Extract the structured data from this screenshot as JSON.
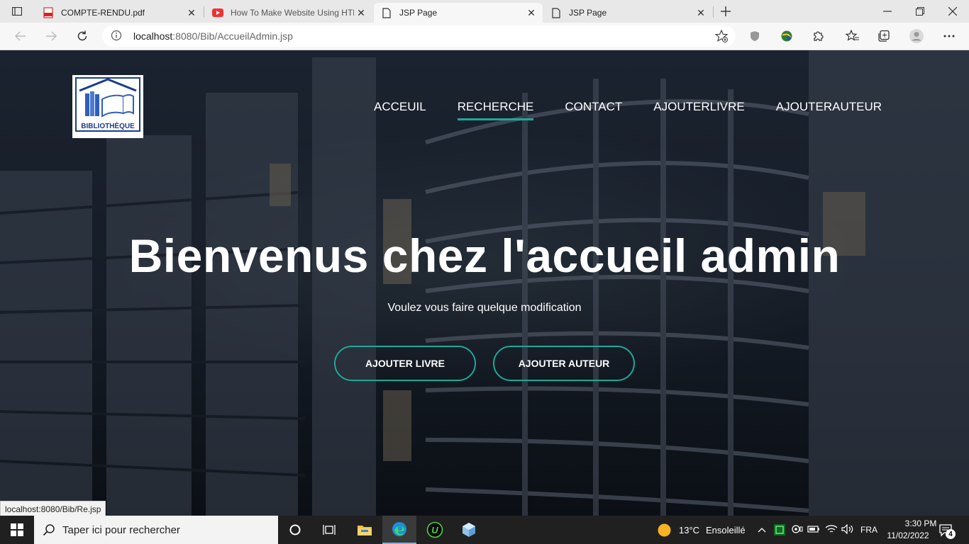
{
  "browser": {
    "tabs": [
      {
        "title": "COMPTE-RENDU.pdf",
        "icon": "pdf-icon",
        "active": false
      },
      {
        "title": "How To Make Website Using HTML",
        "icon": "youtube-icon",
        "active": false
      },
      {
        "title": "JSP Page",
        "icon": "page-icon",
        "active": true
      },
      {
        "title": "JSP Page",
        "icon": "page-icon",
        "active": false
      }
    ],
    "url_host": "localhost",
    "url_rest": ":8080/Bib/AccueilAdmin.jsp",
    "status_url": "localhost:8080/Bib/Re.jsp"
  },
  "site": {
    "logo_text": "BIBLIOTHÈQUE",
    "nav": [
      {
        "label": "ACCEUIL",
        "active": false
      },
      {
        "label": "RECHERCHE",
        "active": true
      },
      {
        "label": "CONTACT",
        "active": false
      },
      {
        "label": "AJOUTERLIVRE",
        "active": false
      },
      {
        "label": "AJOUTERAUTEUR",
        "active": false
      }
    ],
    "hero_title": "Bienvenus chez l'accueil admin",
    "hero_subtitle": "Voulez vous faire quelque modification",
    "buttons": [
      "AJOUTER LIVRE",
      "AJOUTER AUTEUR"
    ],
    "accent_color": "#1fa898"
  },
  "taskbar": {
    "search_placeholder": "Taper ici pour rechercher",
    "weather_temp": "13°C",
    "weather_text": "Ensoleillé",
    "language": "FRA",
    "time": "3:30 PM",
    "date": "11/02/2022",
    "notification_count": "4"
  }
}
